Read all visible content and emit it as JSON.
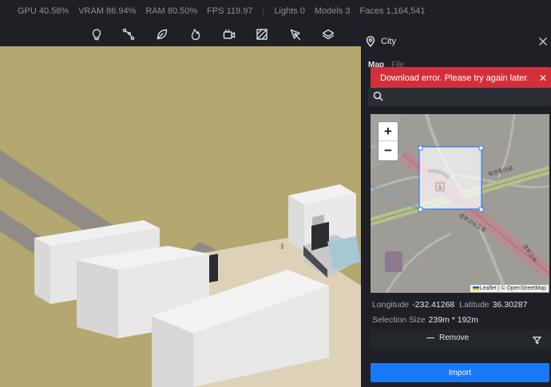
{
  "stats": {
    "gpu": "GPU 40.58%",
    "vram": "VRAM 86.94%",
    "ram": "RAM 80.50%",
    "fps": "FPS 119.97",
    "lights": "Lights 0",
    "models": "Models 3",
    "faces": "Faces 1,164,541"
  },
  "toolbar": {
    "tools": [
      "light-bulb-icon",
      "node-connect-icon",
      "leaf-icon",
      "flame-icon",
      "video-camera-icon",
      "texture-icon",
      "pen-tool-icon",
      "layers-icon"
    ]
  },
  "panel": {
    "title": "City",
    "tabs": [
      "Map",
      "File"
    ],
    "active_tab": "Map",
    "error_message": "Download error. Please try again later.",
    "search_placeholder": "",
    "map": {
      "road_label_1": "경부고속도로",
      "road_label_2": "경부고속",
      "road_label_3": "옥천동이로",
      "marker": "1",
      "zoom_in": "+",
      "zoom_out": "−",
      "attribution": "Leaflet | © OpenStreetMap"
    },
    "longitude_label": "Longitude",
    "longitude_value": "-232.41268",
    "latitude_label": "Latitude",
    "latitude_value": "36.30287",
    "selection_label": "Selection Size",
    "selection_value": "239m * 192m",
    "remove_label": "Remove",
    "import_label": "Import"
  },
  "colors": {
    "accent": "#1978f6",
    "error": "#d32f3a",
    "ground": "#b3a66f"
  }
}
